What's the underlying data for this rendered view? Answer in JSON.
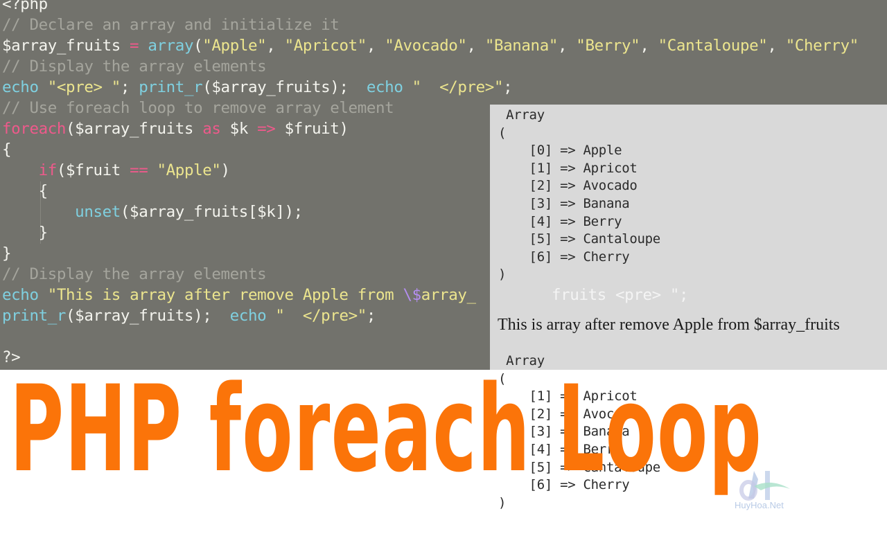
{
  "editor": {
    "lines": [
      [
        {
          "t": "<?php",
          "c": "pl"
        }
      ],
      [
        {
          "t": "// Declare an array and initialize it",
          "c": "cm"
        }
      ],
      [
        {
          "t": "$array_fruits ",
          "c": "pl"
        },
        {
          "t": "=",
          "c": "op"
        },
        {
          "t": " ",
          "c": "pl"
        },
        {
          "t": "array",
          "c": "fn"
        },
        {
          "t": "(",
          "c": "pl"
        },
        {
          "t": "\"Apple\"",
          "c": "str"
        },
        {
          "t": ", ",
          "c": "pl"
        },
        {
          "t": "\"Apricot\"",
          "c": "str"
        },
        {
          "t": ", ",
          "c": "pl"
        },
        {
          "t": "\"Avocado\"",
          "c": "str"
        },
        {
          "t": ", ",
          "c": "pl"
        },
        {
          "t": "\"Banana\"",
          "c": "str"
        },
        {
          "t": ", ",
          "c": "pl"
        },
        {
          "t": "\"Berry\"",
          "c": "str"
        },
        {
          "t": ", ",
          "c": "pl"
        },
        {
          "t": "\"Cantaloupe\"",
          "c": "str"
        },
        {
          "t": ", ",
          "c": "pl"
        },
        {
          "t": "\"Cherry\"",
          "c": "str"
        }
      ],
      [
        {
          "t": "// Display the array elements",
          "c": "cm"
        }
      ],
      [
        {
          "t": "echo",
          "c": "fn"
        },
        {
          "t": " ",
          "c": "pl"
        },
        {
          "t": "\"<pre> \"",
          "c": "str"
        },
        {
          "t": "; ",
          "c": "pl"
        },
        {
          "t": "print_r",
          "c": "fn"
        },
        {
          "t": "($array_fruits);  ",
          "c": "pl"
        },
        {
          "t": "echo",
          "c": "fn"
        },
        {
          "t": " ",
          "c": "pl"
        },
        {
          "t": "\"  </pre>\"",
          "c": "str"
        },
        {
          "t": ";",
          "c": "pl"
        }
      ],
      [
        {
          "t": "// Use foreach loop to remove array element",
          "c": "cm"
        }
      ],
      [
        {
          "t": "foreach",
          "c": "kw"
        },
        {
          "t": "($array_fruits ",
          "c": "pl"
        },
        {
          "t": "as",
          "c": "kw"
        },
        {
          "t": " $k ",
          "c": "pl"
        },
        {
          "t": "=>",
          "c": "op"
        },
        {
          "t": " $fruit)",
          "c": "pl"
        }
      ],
      [
        {
          "t": "{",
          "c": "pl"
        }
      ],
      [
        {
          "t": "    ",
          "c": "pl"
        },
        {
          "t": "if",
          "c": "kw"
        },
        {
          "t": "($fruit ",
          "c": "pl"
        },
        {
          "t": "==",
          "c": "op"
        },
        {
          "t": " ",
          "c": "pl"
        },
        {
          "t": "\"Apple\"",
          "c": "str"
        },
        {
          "t": ")",
          "c": "pl"
        }
      ],
      [
        {
          "t": "    {",
          "c": "pl"
        }
      ],
      [
        {
          "t": "        ",
          "c": "pl"
        },
        {
          "t": "unset",
          "c": "fn"
        },
        {
          "t": "($array_fruits[$k]);",
          "c": "pl"
        }
      ],
      [
        {
          "t": "    }",
          "c": "pl"
        }
      ],
      [
        {
          "t": "}",
          "c": "pl"
        }
      ],
      [
        {
          "t": "// Display the array elements",
          "c": "cm"
        }
      ],
      [
        {
          "t": "echo",
          "c": "fn"
        },
        {
          "t": " ",
          "c": "pl"
        },
        {
          "t": "\"This is array after remove Apple from ",
          "c": "str"
        },
        {
          "t": "\\$",
          "c": "esc"
        },
        {
          "t": "array_",
          "c": "str"
        }
      ],
      [
        {
          "t": "print_r",
          "c": "fn"
        },
        {
          "t": "($array_fruits);  ",
          "c": "pl"
        },
        {
          "t": "echo",
          "c": "fn"
        },
        {
          "t": " ",
          "c": "pl"
        },
        {
          "t": "\"  </pre>\"",
          "c": "str"
        },
        {
          "t": ";",
          "c": "pl"
        }
      ],
      [
        {
          "t": "",
          "c": "pl"
        }
      ],
      [
        {
          "t": "?>",
          "c": "pl"
        }
      ]
    ],
    "overflow_text": "fruits <pre> \";"
  },
  "output": {
    "first_array": {
      "header": "Array",
      "open": "(",
      "items": [
        {
          "index": "[0]",
          "arrow": "=>",
          "value": "Apple"
        },
        {
          "index": "[1]",
          "arrow": "=>",
          "value": "Apricot"
        },
        {
          "index": "[2]",
          "arrow": "=>",
          "value": "Avocado"
        },
        {
          "index": "[3]",
          "arrow": "=>",
          "value": "Banana"
        },
        {
          "index": "[4]",
          "arrow": "=>",
          "value": "Berry"
        },
        {
          "index": "[5]",
          "arrow": "=>",
          "value": "Cantaloupe"
        },
        {
          "index": "[6]",
          "arrow": "=>",
          "value": "Cherry"
        }
      ],
      "close": ")"
    },
    "sentence": "This is array after remove Apple from $array_fruits",
    "second_array": {
      "header": "Array",
      "open": "(",
      "items": [
        {
          "index": "[1]",
          "arrow": "=>",
          "value": "Apricot"
        },
        {
          "index": "[2]",
          "arrow": "=>",
          "value": "Avocado"
        },
        {
          "index": "[3]",
          "arrow": "=>",
          "value": "Banana"
        },
        {
          "index": "[4]",
          "arrow": "=>",
          "value": "Berry"
        },
        {
          "index": "[5]",
          "arrow": "=>",
          "value": "Cantaloupe"
        },
        {
          "index": "[6]",
          "arrow": "=>",
          "value": "Cherry"
        }
      ],
      "close": ")"
    }
  },
  "banner": {
    "title": "PHP foreach Loop",
    "color": "#fb7409"
  },
  "watermark": {
    "icon": "huyhoa-logo-icon",
    "text": "HuyHoa.Net"
  },
  "colors": {
    "editor_bg": "#72726c",
    "output_bg": "#d9d9d9",
    "comment": "#a5a59d",
    "keyword": "#ee5a8b",
    "function": "#7fd0e0",
    "string": "#ece58e"
  }
}
